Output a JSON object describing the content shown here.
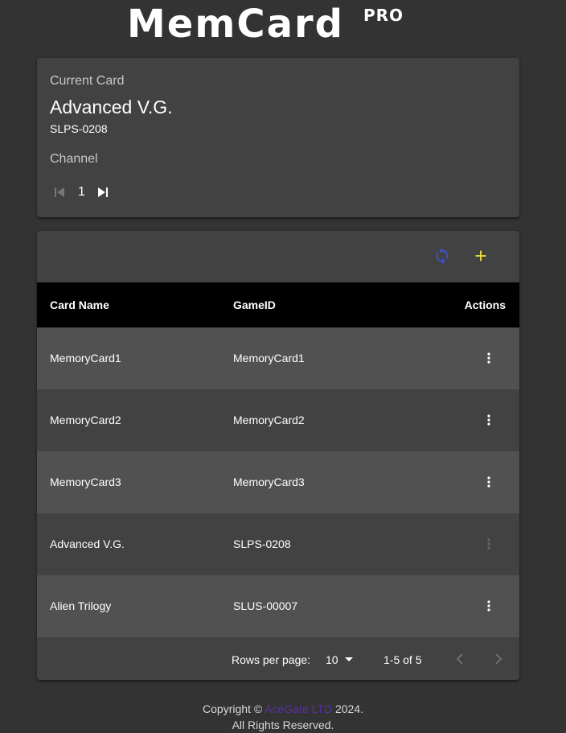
{
  "header": {
    "logo_text": "MemCard",
    "logo_suffix": "PRO"
  },
  "current_card": {
    "label": "Current Card",
    "name": "Advanced V.G.",
    "game_id": "SLPS-0208",
    "channel_label": "Channel",
    "channel_value": "1"
  },
  "toolbar": {
    "refresh_icon": "refresh-icon",
    "add_icon": "add-icon",
    "refresh_color": "#3f51d8",
    "add_color": "#f5e23a"
  },
  "table": {
    "columns": [
      "Card Name",
      "GameID",
      "Actions"
    ],
    "rows": [
      {
        "name": "MemoryCard1",
        "game_id": "MemoryCard1",
        "actions_enabled": true
      },
      {
        "name": "MemoryCard2",
        "game_id": "MemoryCard2",
        "actions_enabled": true
      },
      {
        "name": "MemoryCard3",
        "game_id": "MemoryCard3",
        "actions_enabled": true
      },
      {
        "name": "Advanced V.G.",
        "game_id": "SLPS-0208",
        "actions_enabled": false
      },
      {
        "name": "Alien Trilogy",
        "game_id": "SLUS-00007",
        "actions_enabled": true
      }
    ]
  },
  "pagination": {
    "rows_per_page_label": "Rows per page:",
    "rows_per_page_value": "10",
    "range_text": "1-5 of 5"
  },
  "footer": {
    "copyright_prefix": "Copyright ©",
    "company": "AceGate LTD",
    "year_suffix": "2024.",
    "rights": "All Rights Reserved."
  }
}
